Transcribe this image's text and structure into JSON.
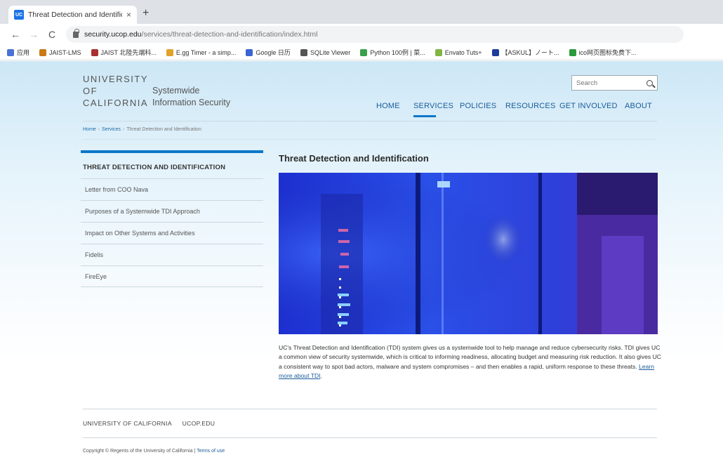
{
  "browser": {
    "tab_title": "Threat Detection and Identificat",
    "tab_close": "×",
    "new_tab": "+",
    "url_host": "security.ucop.edu",
    "url_path": "/services/threat-detection-and-identification/index.html",
    "bookmarks": [
      {
        "label": "应用",
        "color": "#4a72d8"
      },
      {
        "label": "JAIST-LMS",
        "color": "#c87a15"
      },
      {
        "label": "JAIST 北陸先端科...",
        "color": "#a83030"
      },
      {
        "label": "E.gg Timer - a simp...",
        "color": "#e2a12b"
      },
      {
        "label": "Google 日历",
        "color": "#3a64d1"
      },
      {
        "label": "SQLite Viewer",
        "color": "#555555"
      },
      {
        "label": "Python 100例 | 菜...",
        "color": "#3aa04a"
      },
      {
        "label": "Envato Tuts+",
        "color": "#82b541"
      },
      {
        "label": "【ASKUL】ノート...",
        "color": "#1e3c9a"
      },
      {
        "label": "ico网页图标免费下...",
        "color": "#2c9a3a"
      }
    ]
  },
  "site": {
    "logo_lines": [
      "UNIVERSITY",
      "OF",
      "CALIFORNIA"
    ],
    "logo_sub_1": "Systemwide",
    "logo_sub_2": "Information Security",
    "search_placeholder": "Search"
  },
  "nav": [
    {
      "label": "HOME",
      "active": false
    },
    {
      "label": "SERVICES",
      "active": true
    },
    {
      "label": "POLICIES",
      "active": false
    },
    {
      "label": "RESOURCES",
      "active": false
    },
    {
      "label": "GET INVOLVED",
      "active": false
    },
    {
      "label": "ABOUT",
      "active": false
    }
  ],
  "breadcrumb": {
    "home": "Home",
    "services": "Services",
    "current": "Threat Detection and Identification",
    "separator": "›"
  },
  "sidebar": {
    "heading": "THREAT DETECTION AND IDENTIFICATION",
    "items": [
      {
        "label": "Letter from COO Nava"
      },
      {
        "label": "Purposes of a Systemwide TDI Approach"
      },
      {
        "label": "Impact on Other Systems and Activities"
      },
      {
        "label": "Fidelis"
      },
      {
        "label": "FireEye"
      }
    ]
  },
  "main": {
    "title": "Threat Detection and Identification",
    "body": "UC's Threat Detection and Identification (TDI) system gives us a systemwide tool to help manage and reduce cybersecurity risks. TDI gives UC a common view of security systemwide, which is critical to informing readiness, allocating budget and measuring risk reduction. It also gives UC a consistent way to spot bad actors, malware and system compromises – and then enables a rapid, uniform response to these threats.",
    "link": "Learn more about TDI"
  },
  "footer": {
    "links": [
      "UNIVERSITY OF CALIFORNIA",
      "UCOP.EDU"
    ],
    "copyright": "Copyright © Regents of the University of California |",
    "terms": "Terms of use"
  }
}
